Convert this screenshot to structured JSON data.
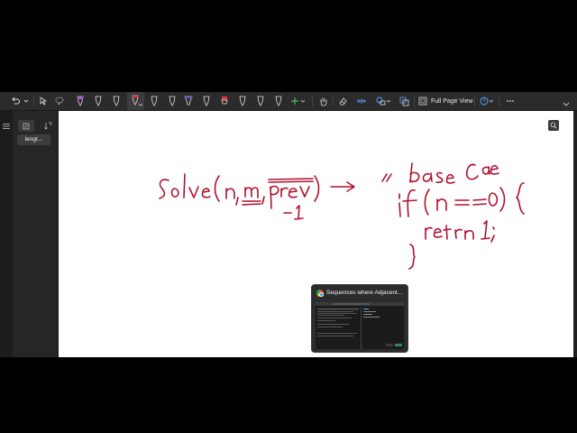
{
  "toolbar": {
    "icons": [
      "undo-icon",
      "redo-dropdown-icon",
      "select-cursor-icon",
      "lasso-icon",
      "pen-purple-icon",
      "pen-white-icon",
      "pen-white-2-icon",
      "pen-red-selected-icon",
      "pen-white-3-icon",
      "pen-white-4-icon",
      "highlighter-purple-icon",
      "pen-white-5-icon",
      "highlighter-red-icon",
      "pen-white-6-icon",
      "pen-white-7-icon",
      "pen-white-8-icon",
      "add-pen-icon",
      "touch-hand-icon",
      "eraser-icon",
      "ruler-icon",
      "shapes-icon",
      "convert-icon"
    ],
    "full_page_label": "Full Page View",
    "help_icon": "help-circle-icon",
    "more_icon": "more-icon",
    "collapse_icon": "chevron-down-icon"
  },
  "sidebar": {
    "menu_icon": "hamburger-icon",
    "add_page_icon": "add-page-icon",
    "sort_icon": "sort-icon",
    "page_label": "lengt..."
  },
  "canvas": {
    "zoom_icon": "search-icon",
    "ink_color": "#b0102c",
    "ink_lines": [
      "Solve(n, m, prev) ->",
      "-1",
      "// base case",
      "if (n == 0) {",
      "return 1;",
      "}"
    ]
  },
  "taskbar_preview": {
    "title": "Sequences where Adjacent...",
    "icon": "chrome-icon"
  }
}
